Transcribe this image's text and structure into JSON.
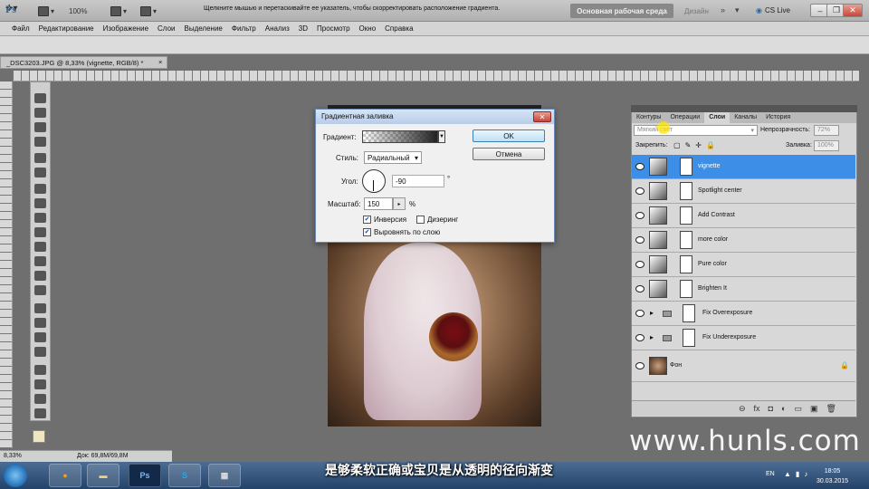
{
  "app": {
    "logo": "Ps",
    "zoom_pct": "100%"
  },
  "workspace": {
    "active": "Основная рабочая среда",
    "design": "Дизайн",
    "cslive": "CS Live"
  },
  "menu": [
    "Файл",
    "Редактирование",
    "Изображение",
    "Слои",
    "Выделение",
    "Фильтр",
    "Анализ",
    "3D",
    "Просмотр",
    "Окно",
    "Справка"
  ],
  "options": {
    "hint": "Щелкните мышью и перетаскивайте ее указатель, чтобы скорректировать расположение градиента."
  },
  "document": {
    "tab": "_DSC3203.JPG @ 8,33% (vignette, RGB/8) *",
    "zoom": "8,33%",
    "doc_size": "Док: 69,8M/69,8M"
  },
  "dialog": {
    "title": "Градиентная заливка",
    "gradient_label": "Градиент:",
    "style_label": "Стиль:",
    "style_value": "Радиальный",
    "angle_label": "Угол:",
    "angle_value": "-90",
    "degree": "°",
    "scale_label": "Масштаб:",
    "scale_value": "150",
    "percent": "%",
    "reverse": {
      "label": "Инверсия",
      "checked": true
    },
    "dither": {
      "label": "Дизеринг",
      "checked": false
    },
    "align": {
      "label": "Выровнять по слою",
      "checked": true
    },
    "ok": "OK",
    "cancel": "Отмена"
  },
  "panel": {
    "tabs": [
      "Контуры",
      "Операции",
      "Слои",
      "Каналы",
      "История"
    ],
    "active_tab": "Слои",
    "blend_mode": "Мягкий свет",
    "opacity_label": "Непрозрачность:",
    "opacity": "72%",
    "lock_label": "Закрепить:",
    "fill_label": "Заливка:",
    "fill": "100%",
    "layers": [
      {
        "name": "vignette",
        "selected": true,
        "type": "adjust"
      },
      {
        "name": "Spotlight center",
        "selected": false,
        "type": "adjust"
      },
      {
        "name": "Add Contrast",
        "selected": false,
        "type": "adjust"
      },
      {
        "name": "more color",
        "selected": false,
        "type": "adjust"
      },
      {
        "name": "Pure color",
        "selected": false,
        "type": "adjust"
      },
      {
        "name": "Brighten It",
        "selected": false,
        "type": "adjust"
      },
      {
        "name": "Fix Overexposure",
        "selected": false,
        "type": "group"
      },
      {
        "name": "Fix Underexposure",
        "selected": false,
        "type": "group"
      },
      {
        "name": "Фон",
        "selected": false,
        "type": "background"
      }
    ]
  },
  "taskbar": {
    "lang": "EN",
    "time": "18:05",
    "date": "30.03.2015",
    "ps": "Ps"
  },
  "overlay": {
    "subtitle": "是够柔软正确或宝贝是从透明的径向渐变",
    "watermark": "www.hunls.com"
  }
}
